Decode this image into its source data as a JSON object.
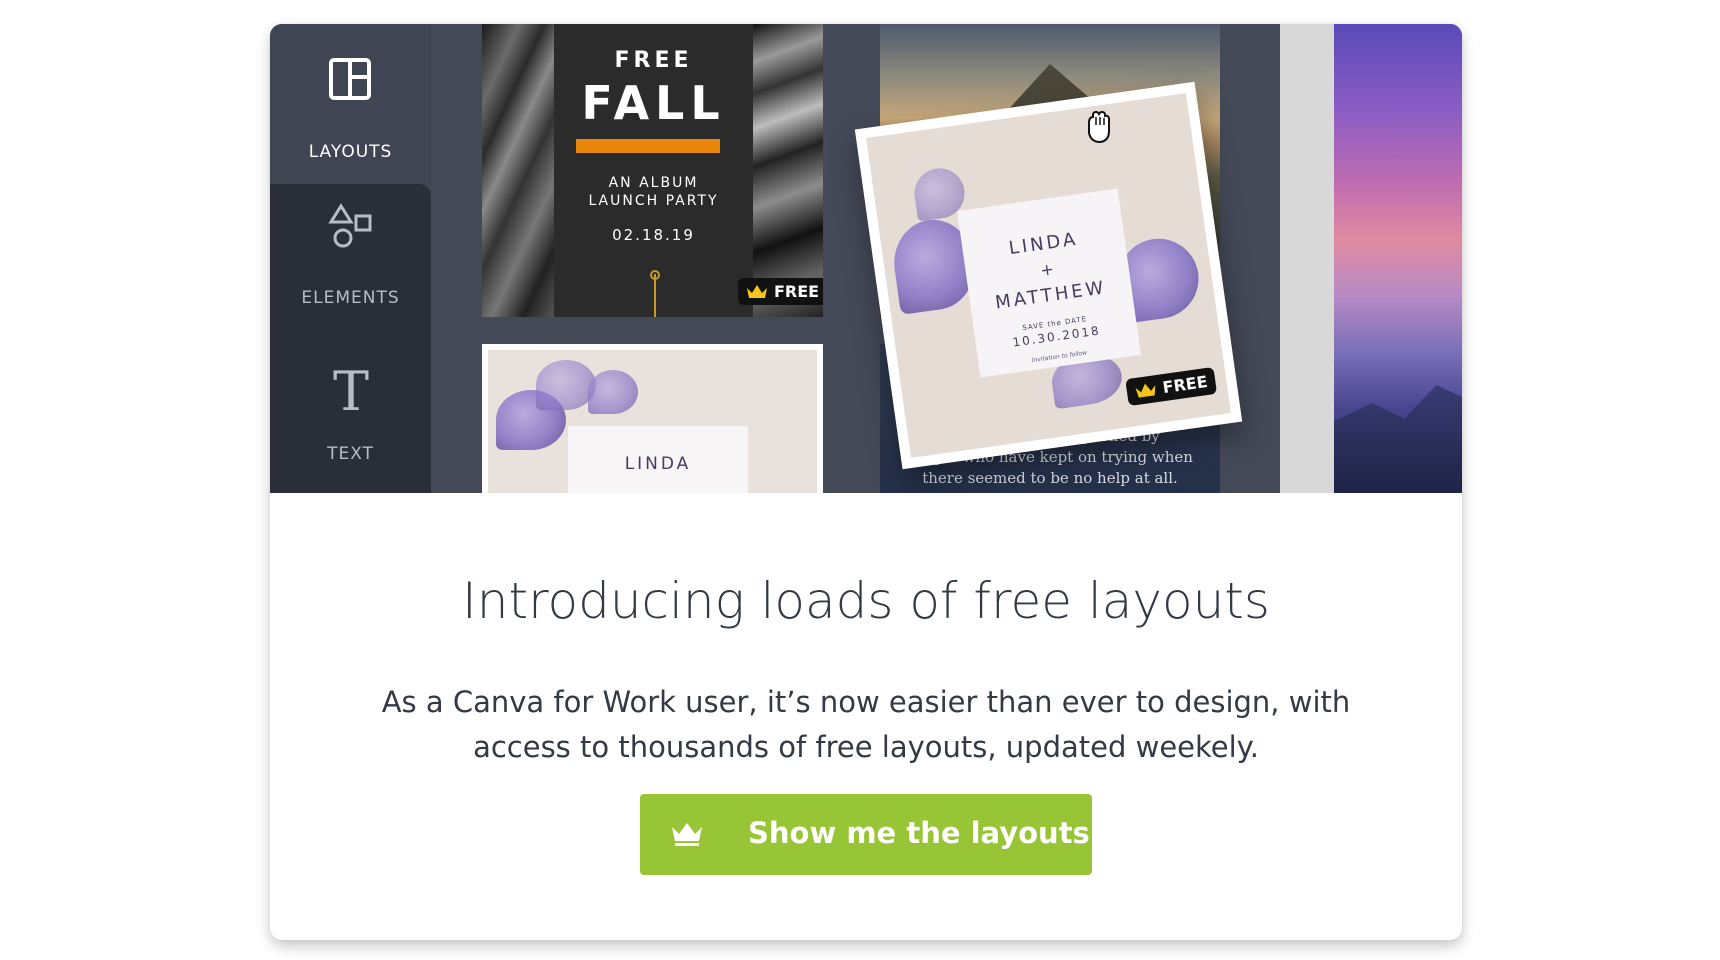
{
  "sidebar": {
    "items": [
      {
        "label": "LAYOUTS",
        "icon": "layouts-icon"
      },
      {
        "label": "ELEMENTS",
        "icon": "elements-icon"
      },
      {
        "label": "TEXT",
        "icon": "text-icon"
      }
    ]
  },
  "templates": {
    "fall": {
      "top": "FREE",
      "title": "FALL",
      "subtitle_line1": "AN ALBUM",
      "subtitle_line2": "LAUNCH PARTY",
      "date": "02.18.19",
      "badge": "FREE"
    },
    "wedding_small": {
      "name": "LINDA"
    },
    "wedding_card": {
      "name1": "LINDA",
      "plus": "+",
      "name2": "MATTHEW",
      "save_the_date": "SAVE the DATE",
      "date": "10.30.2018",
      "invitation": "Invitation to follow",
      "badge": "FREE"
    },
    "quote": {
      "line1": "Mos                    mplished by",
      "line2": "people who have kept on trying when",
      "line3": "there seemed to be no help at all."
    }
  },
  "content": {
    "headline": "Introducing loads of free layouts",
    "description_line1": "As a Canva for Work user, it’s now easier than ever to design, with",
    "description_line2": "access to thousands of free layouts, updated weekely.",
    "cta_label": "Show me the layouts"
  },
  "colors": {
    "cta_green": "#97c536",
    "sidebar_bg": "#3f4552",
    "fall_accent": "#e8860c",
    "crown_gold": "#f5c518"
  }
}
